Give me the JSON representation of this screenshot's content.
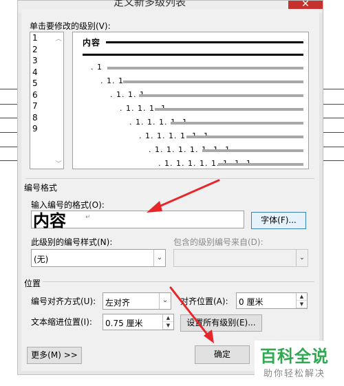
{
  "window": {
    "title": "定义新多级列表",
    "close_glyph": "✕"
  },
  "level_select": {
    "label": "单击要修改的级别(V):",
    "items": [
      "1",
      "2",
      "3",
      "4",
      "5",
      "6",
      "7",
      "8",
      "9"
    ],
    "selected": "1"
  },
  "preview": {
    "heading": "内容",
    "rows": [
      ". 1",
      ". 1. 1",
      ". 1. 1. 1",
      ". 1. 1. 1. 1",
      ". 1. 1. 1. 1. 1",
      ". 1. 1. 1. 1. 1. 1",
      ". 1. 1. 1. 1. 1. 1. 1",
      ". 1. 1. 1. 1. 1. 1. 1. 1"
    ]
  },
  "number_format": {
    "section_label": "编号格式",
    "input_label": "输入编号的格式(O):",
    "input_value": "内容",
    "font_button": "字体(F)...",
    "style_label": "此级别的编号样式(N):",
    "style_value": "(无)",
    "include_label": "包含的级别编号来自(D):",
    "include_value": ""
  },
  "position": {
    "section_label": "位置",
    "align_label": "编号对齐方式(U):",
    "align_value": "左对齐",
    "align_at_label": "对齐位置(A):",
    "align_at_value": "0 厘米",
    "indent_label": "文本缩进位置(I):",
    "indent_value": "0.75 厘米",
    "set_all_button": "设置所有级别(E)..."
  },
  "footer": {
    "more_button": "更多(M) >>",
    "ok_button": "确定"
  },
  "watermark": {
    "main": "百科全说",
    "sub": "助你轻松解决",
    "color": "#2fa84f"
  },
  "colors": {
    "arrow": "#e8262a"
  }
}
